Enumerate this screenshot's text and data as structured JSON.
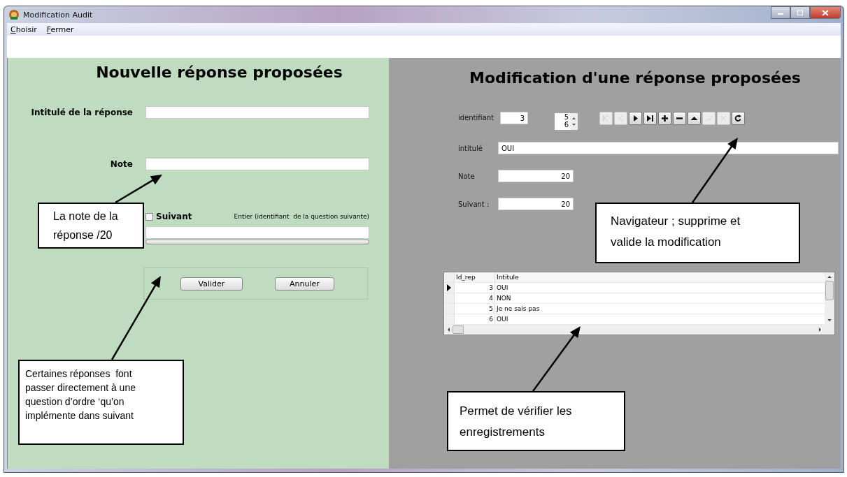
{
  "window": {
    "title": "Modification Audit",
    "controls": [
      {
        "kind": "minimize"
      },
      {
        "kind": "maximize"
      },
      {
        "kind": "close"
      }
    ]
  },
  "menu": [
    {
      "label": "Choisir",
      "underline_first": true
    },
    {
      "label": "Fermer",
      "underline_first": true
    }
  ],
  "new_panel": {
    "title": "Nouvelle réponse proposées",
    "intitule": {
      "label": "Intitulé de la réponse"
    },
    "note": {
      "label": "Note"
    },
    "suivant": {
      "label": "Suivant",
      "checked": false,
      "hint": "Entier (identifiant  de la question suivante)"
    },
    "buttons": [
      "Valider",
      "Annuler"
    ]
  },
  "edit_panel": {
    "title": "Modification d'une réponse proposées",
    "identifiant": {
      "label": "identifiant",
      "value": "3"
    },
    "spinner": [
      "5",
      "6"
    ],
    "navigator": [
      {
        "kind": "first",
        "disabled": true
      },
      {
        "kind": "prior",
        "disabled": true
      },
      {
        "kind": "next",
        "disabled": false
      },
      {
        "kind": "last",
        "disabled": false
      },
      {
        "kind": "insert",
        "disabled": false
      },
      {
        "kind": "delete",
        "disabled": false
      },
      {
        "kind": "edit",
        "disabled": false
      },
      {
        "kind": "post",
        "disabled": true
      },
      {
        "kind": "cancel",
        "disabled": true
      },
      {
        "kind": "refresh",
        "disabled": false
      }
    ],
    "intitule": {
      "label": "intitulé",
      "value": "OUI"
    },
    "note": {
      "label": "Note",
      "value": "20"
    },
    "suivant": {
      "label": "Suivant :",
      "value": "20"
    },
    "grid": {
      "columns": [
        "Id_rep",
        "Intitule"
      ],
      "rows": [
        {
          "cells": [
            "3",
            "OUI"
          ],
          "selected": true
        },
        {
          "cells": [
            "4",
            "NON"
          ],
          "selected": false
        },
        {
          "cells": [
            "5",
            "Je ne sais pas"
          ],
          "selected": false
        },
        {
          "cells": [
            "6",
            "OUI"
          ],
          "selected": false
        }
      ]
    }
  },
  "callouts": [
    {
      "text": "La note de la réponse /20"
    },
    {
      "text": "Certaines réponses  font passer directement à une question d’ordre ‘qu’on implémente dans suivant"
    },
    {
      "text": "Navigateur ; supprime et valide la modification"
    },
    {
      "text": "Permet de vérifier les enregistrements"
    }
  ]
}
